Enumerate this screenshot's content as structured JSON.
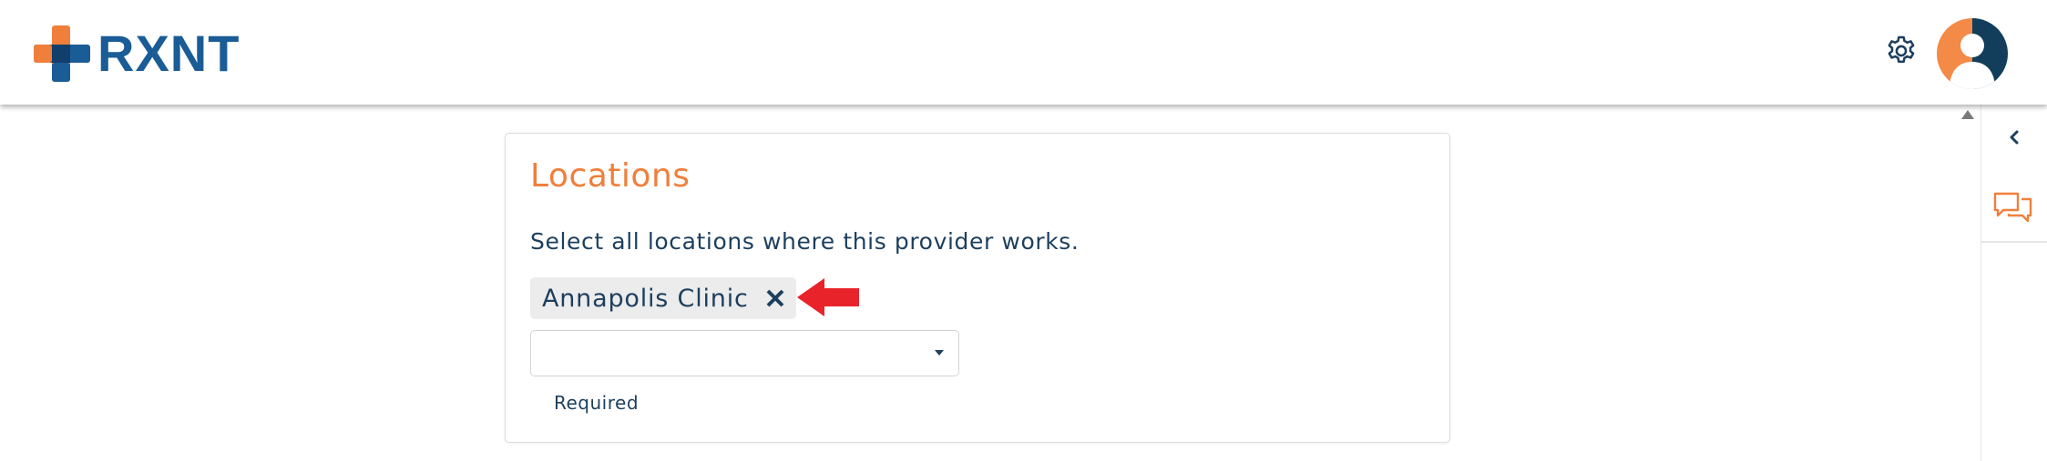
{
  "header": {
    "logo_text": "RXNT",
    "settings_icon": "gear-icon",
    "avatar_icon": "user-avatar-icon"
  },
  "colors": {
    "brand_orange": "#f07f3c",
    "brand_blue": "#1a5c96",
    "text_dark": "#1d3f5e",
    "annotation_red": "#e8232a"
  },
  "locations": {
    "title": "Locations",
    "description": "Select all locations where this provider works.",
    "selected": [
      {
        "label": "Annapolis Clinic"
      }
    ],
    "select_value": "",
    "hint": "Required"
  },
  "sidebar": {
    "collapse_icon": "chevron-left-icon",
    "chat_icon": "chat-bubbles-icon"
  }
}
